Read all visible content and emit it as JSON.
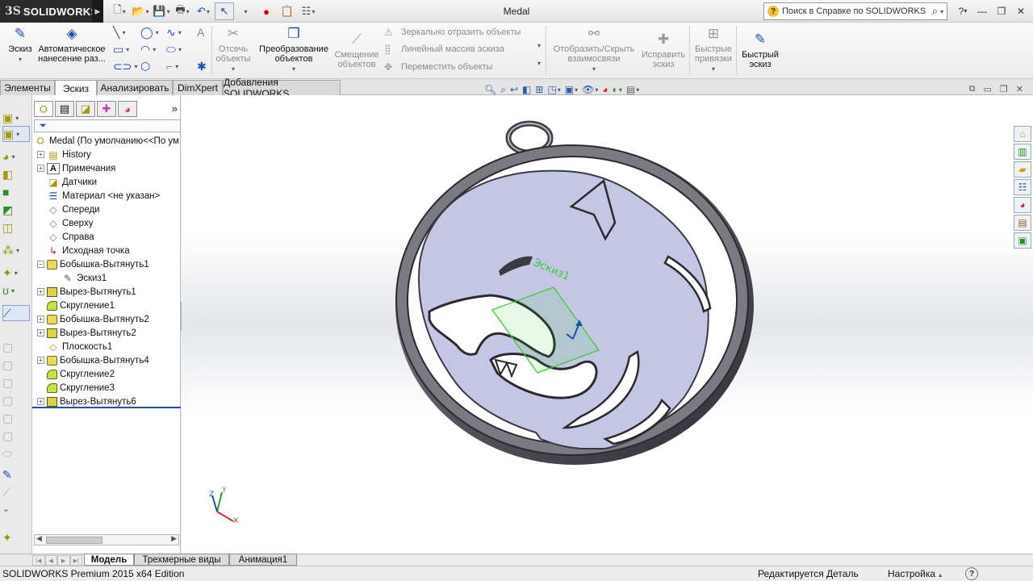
{
  "app": {
    "logo_ds": "3S",
    "logo_name": "SOLIDWORKS",
    "window_title": "Medal",
    "help_search_placeholder": "Поиск в Справке по SOLIDWORKS",
    "help_icon": "?"
  },
  "ribbon": {
    "sketch": "Эскиз",
    "smart_dim_line1": "Автоматическое",
    "smart_dim_line2": "нанесение раз...",
    "trim_line1": "Отсечь",
    "trim_line2": "объекты",
    "convert_line1": "Преобразование",
    "convert_line2": "объектов",
    "offset_line1": "Смещение",
    "offset_line2": "объектов",
    "mirror": "Зеркально отразить объекты",
    "linear_pattern": "Линейный массив эскиза",
    "move": "Переместить объекты",
    "display_rel_line1": "Отобразить/Скрыть",
    "display_rel_line2": "взаимосвязи",
    "repair_line1": "Исправить",
    "repair_line2": "эскиз",
    "quick_snaps_line1": "Быстрые",
    "quick_snaps_line2": "привязки",
    "rapid_line1": "Быстрый",
    "rapid_line2": "эскиз"
  },
  "tabs": [
    "Элементы",
    "Эскиз",
    "Анализировать",
    "DimXpert",
    "Добавления SOLIDWORKS"
  ],
  "active_tab": "Эскиз",
  "tree": {
    "root": "Medal  (По умолчанию<<По ум",
    "items": [
      {
        "label": "History",
        "icon": "history-folder-icon",
        "expandable": true
      },
      {
        "label": "Примечания",
        "icon": "annotations-icon",
        "expandable": true
      },
      {
        "label": "Датчики",
        "icon": "sensors-icon",
        "expandable": false
      },
      {
        "label": "Материал <не указан>",
        "icon": "material-icon",
        "expandable": false
      },
      {
        "label": "Спереди",
        "icon": "plane-icon",
        "expandable": false
      },
      {
        "label": "Сверху",
        "icon": "plane-icon",
        "expandable": false
      },
      {
        "label": "Справа",
        "icon": "plane-icon",
        "expandable": false
      },
      {
        "label": "Исходная точка",
        "icon": "origin-icon",
        "expandable": false
      },
      {
        "label": "Бобышка-Вытянуть1",
        "icon": "boss-extrude-icon",
        "expandable": true,
        "expanded": true
      },
      {
        "label": "Эскиз1",
        "icon": "sketch-icon",
        "expandable": false,
        "child": true
      },
      {
        "label": "Вырез-Вытянуть1",
        "icon": "cut-extrude-icon",
        "expandable": true
      },
      {
        "label": "Скругление1",
        "icon": "fillet-icon",
        "expandable": false
      },
      {
        "label": "Бобышка-Вытянуть2",
        "icon": "boss-extrude-icon",
        "expandable": true
      },
      {
        "label": "Вырез-Вытянуть2",
        "icon": "cut-extrude-icon",
        "expandable": true
      },
      {
        "label": "Плоскость1",
        "icon": "plane-icon",
        "expandable": false
      },
      {
        "label": "Бобышка-Вытянуть4",
        "icon": "boss-extrude-icon",
        "expandable": true
      },
      {
        "label": "Скругление2",
        "icon": "fillet-icon",
        "expandable": false
      },
      {
        "label": "Скругление3",
        "icon": "fillet-icon",
        "expandable": false
      },
      {
        "label": "Вырез-Вытянуть6",
        "icon": "cut-extrude-icon",
        "expandable": true
      }
    ]
  },
  "model": {
    "sketch_label": "Эскиз1",
    "triad_x": "X",
    "triad_y": "Y",
    "triad_z": "Z"
  },
  "bottom_tabs": [
    "Модель",
    "Трехмерные виды",
    "Анимация1"
  ],
  "active_bottom_tab": "Модель",
  "status": {
    "edition": "SOLIDWORKS Premium 2015 x64 Edition",
    "editing": "Редактируется Деталь",
    "customize": "Настройка",
    "help": "?"
  },
  "colors": {
    "accent": "#1f4fb0",
    "medal_face": "#c5c6e4",
    "medal_rim": "#6a6a72",
    "sketch_green": "#33cc33"
  }
}
